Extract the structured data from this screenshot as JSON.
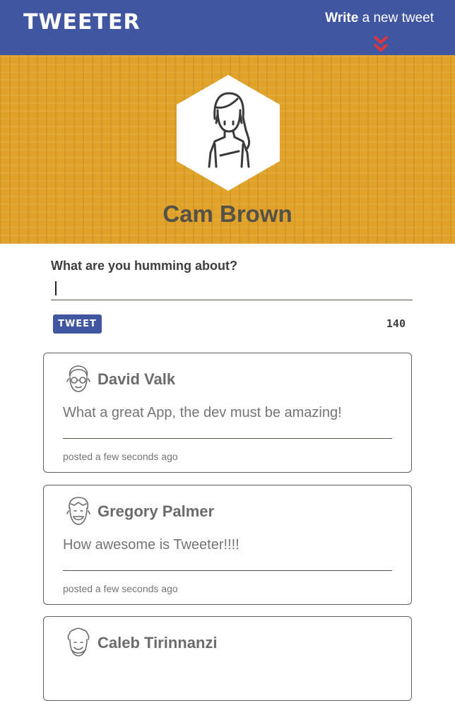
{
  "nav": {
    "brand": "TWEETER",
    "write_bold": "Write",
    "write_rest": " a new tweet"
  },
  "profile": {
    "name": "Cam Brown",
    "header_color": "#e0a229"
  },
  "compose": {
    "label": "What are you humming about?",
    "value": "",
    "button_label": "TWEET",
    "counter": "140"
  },
  "tweets": [
    {
      "name": "David Valk",
      "body": "What a great App, the dev must be amazing!",
      "meta": "posted a few seconds ago",
      "icon": "glasses-avatar-icon"
    },
    {
      "name": "Gregory Palmer",
      "body": "How awesome is Tweeter!!!!",
      "meta": "posted a few seconds ago",
      "icon": "smiling-man-avatar-icon"
    },
    {
      "name": "Caleb Tirinnanzi",
      "icon": "curly-hair-avatar-icon"
    }
  ],
  "colors": {
    "nav": "#4056a1",
    "accent_red": "#d9363e"
  }
}
